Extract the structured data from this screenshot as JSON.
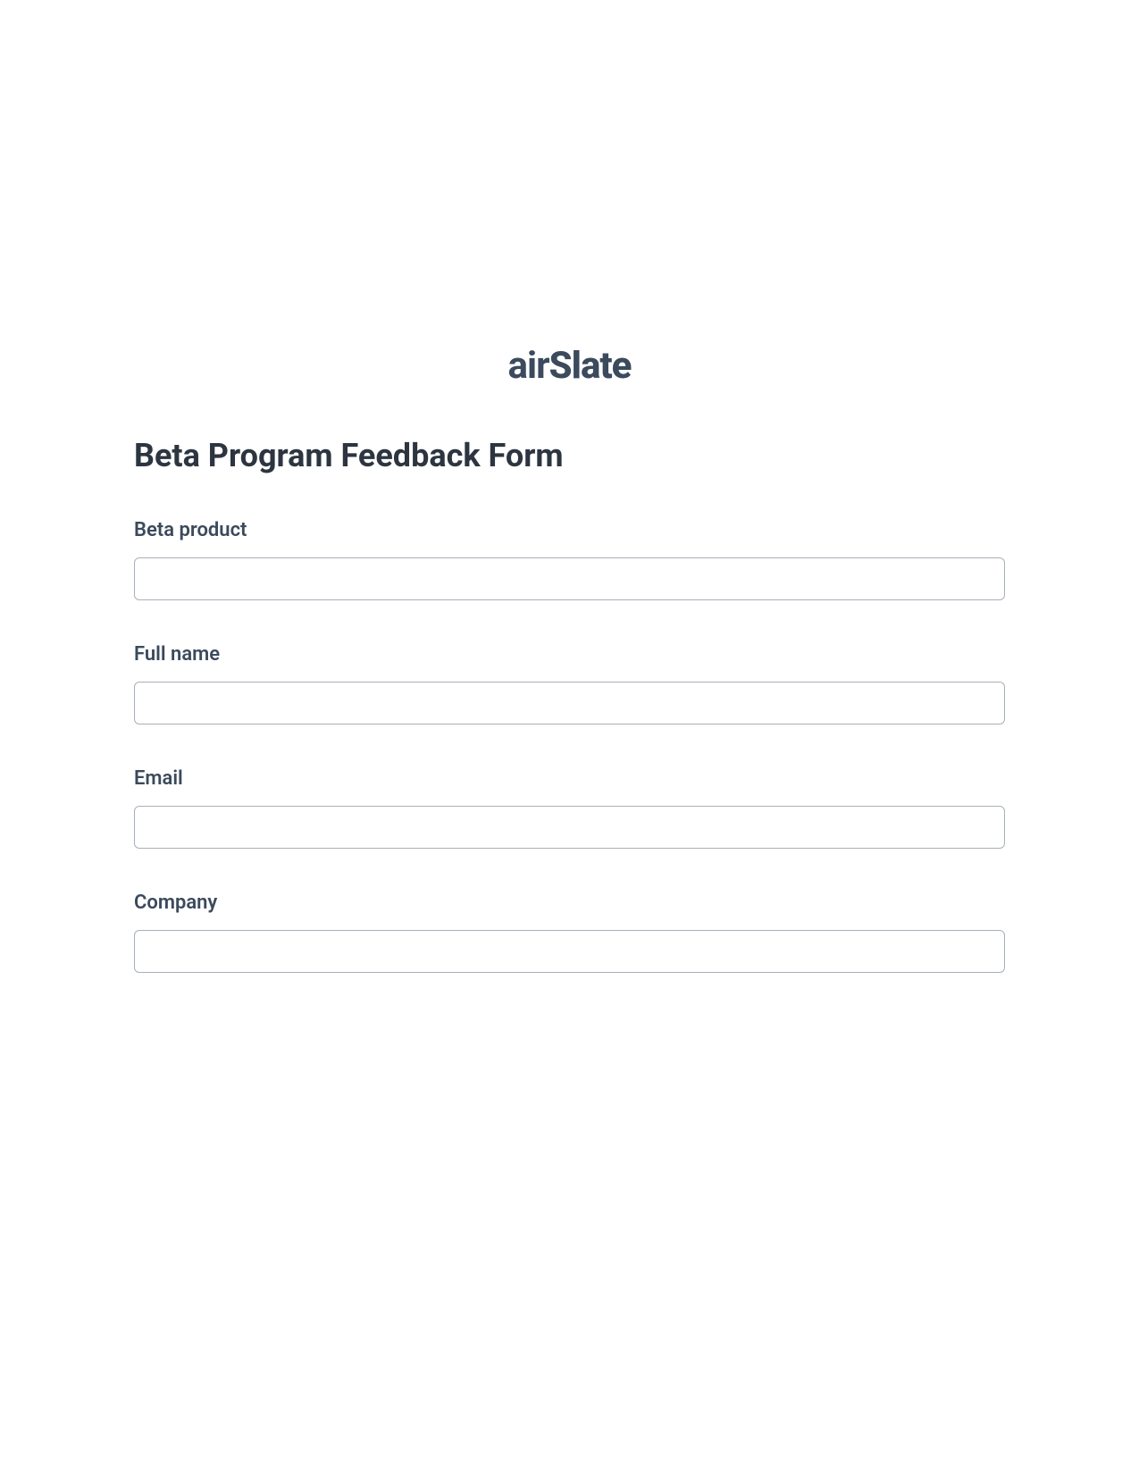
{
  "logo": {
    "text_light": "air",
    "text_bold": "Slate"
  },
  "form": {
    "title": "Beta Program Feedback Form",
    "fields": [
      {
        "label": "Beta product",
        "value": ""
      },
      {
        "label": "Full name",
        "value": ""
      },
      {
        "label": "Email",
        "value": ""
      },
      {
        "label": "Company",
        "value": ""
      }
    ]
  }
}
